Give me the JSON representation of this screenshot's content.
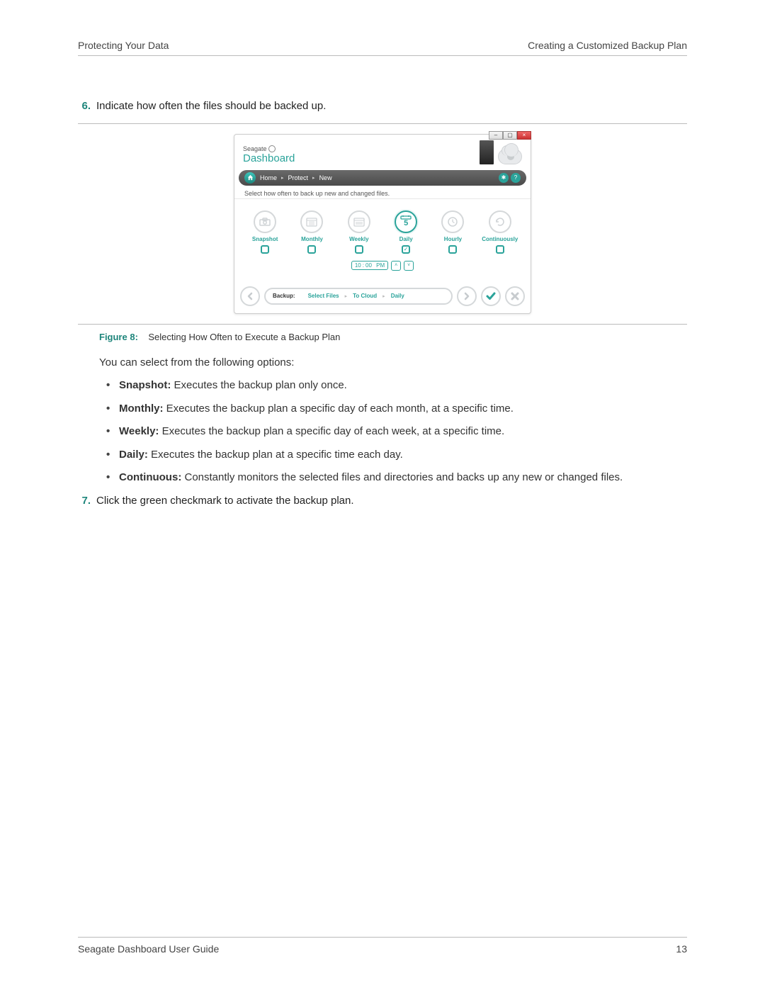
{
  "header": {
    "left": "Protecting Your Data",
    "right": "Creating a Customized Backup Plan"
  },
  "steps": {
    "six": {
      "num": "6.",
      "text": "Indicate how often the files should be backed up."
    },
    "seven": {
      "num": "7.",
      "text": "Click the green checkmark to activate the backup plan."
    }
  },
  "app": {
    "brand_top": "Seagate",
    "brand_bottom": "Dashboard",
    "breadcrumb": {
      "home": "Home",
      "protect": "Protect",
      "new": "New"
    },
    "instruction": "Select how often to back up new and changed files.",
    "freq": {
      "snapshot": "Snapshot",
      "monthly": "Monthly",
      "weekly": "Weekly",
      "daily": "Daily",
      "daily_num": "5",
      "hourly": "Hourly",
      "continuously": "Continuously"
    },
    "time": {
      "h": "10",
      "sep": ":",
      "m": "00",
      "ampm": "PM"
    },
    "bottom": {
      "label": "Backup:",
      "s1": "Select Files",
      "s2": "To Cloud",
      "s3": "Daily"
    }
  },
  "figure": {
    "label": "Figure 8:",
    "caption": "Selecting How Often to Execute a Backup Plan"
  },
  "intro": "You can select from the following options:",
  "options": {
    "snapshot": {
      "name": "Snapshot:",
      "desc": " Executes the backup plan only once."
    },
    "monthly": {
      "name": "Monthly:",
      "desc": " Executes the backup plan a specific day of each month, at a specific time."
    },
    "weekly": {
      "name": "Weekly:",
      "desc": " Executes the backup plan a specific day of each week, at a specific time."
    },
    "daily": {
      "name": "Daily:",
      "desc": " Executes the backup plan at a specific time each day."
    },
    "continuous": {
      "name": "Continuous:",
      "desc": " Constantly monitors the selected files and directories and backs up any new or changed files."
    }
  },
  "footer": {
    "left": "Seagate Dashboard User Guide",
    "right": "13"
  }
}
